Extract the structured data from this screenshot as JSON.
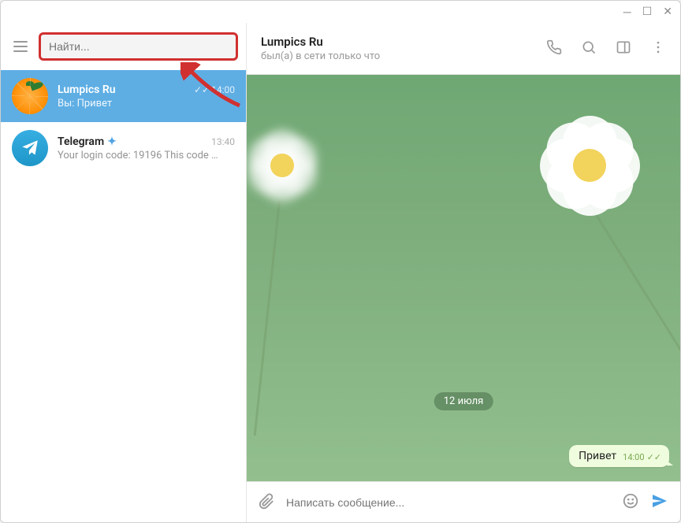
{
  "search": {
    "placeholder": "Найти..."
  },
  "header": {
    "title": "Lumpics Ru",
    "status": "был(а) в сети только что"
  },
  "chats": [
    {
      "name": "Lumpics Ru",
      "time": "14:00",
      "preview": "Вы: Привет",
      "active": true
    },
    {
      "name": "Telegram",
      "time": "13:40",
      "preview": "Your login code: 19196  This code …",
      "verified": true
    }
  ],
  "date_label": "12 июля",
  "message": {
    "text": "Привет",
    "time": "14:00"
  },
  "composer": {
    "placeholder": "Написать сообщение..."
  }
}
